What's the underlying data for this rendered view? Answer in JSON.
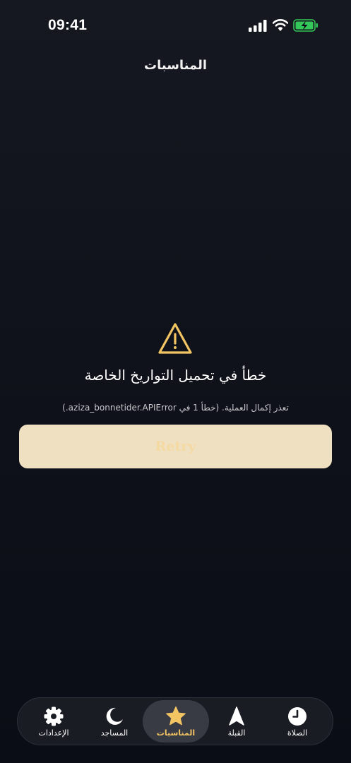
{
  "status_bar": {
    "time": "09:41"
  },
  "header": {
    "title": "المناسبات"
  },
  "error": {
    "title": "خطأ في تحميل التواريخ الخاصة",
    "detail": "تعذر إكمال العملية. (خطأ 1 في aziza_bonnetider.APIError.)",
    "retry_label": "Retry"
  },
  "tab_bar": {
    "tabs": [
      {
        "label": "الإعدادات",
        "icon": "gear-icon",
        "active": false
      },
      {
        "label": "المساجد",
        "icon": "moon-icon",
        "active": false
      },
      {
        "label": "المناسبات",
        "icon": "star-icon",
        "active": true
      },
      {
        "label": "القبلة",
        "icon": "compass-arrow-icon",
        "active": false
      },
      {
        "label": "الصلاة",
        "icon": "clock-icon",
        "active": false
      }
    ]
  },
  "colors": {
    "accent": "#f3c562",
    "button_bg": "#efe0c2",
    "battery_green": "#34c759",
    "background": "#10121b"
  }
}
